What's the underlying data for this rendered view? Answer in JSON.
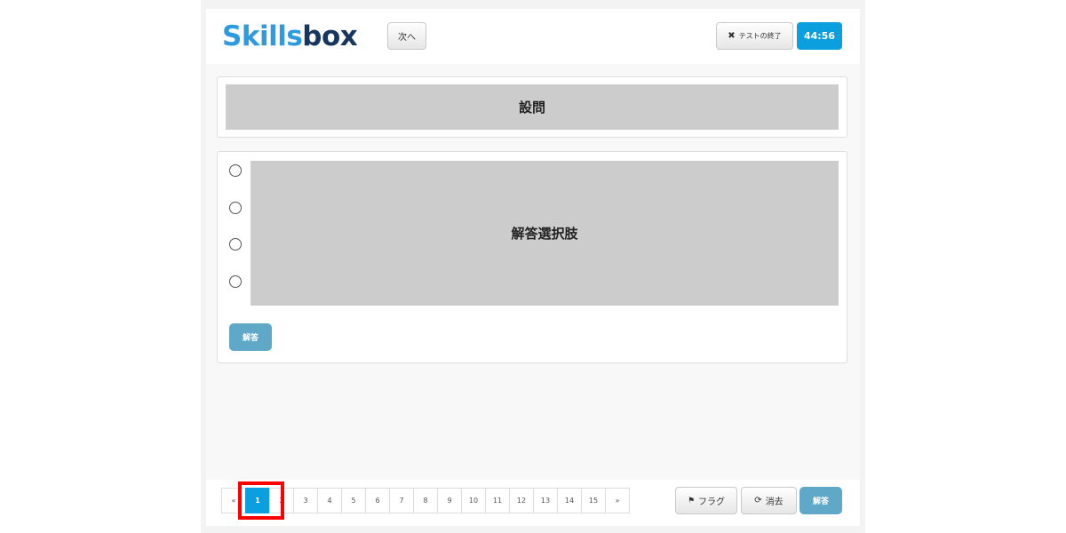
{
  "header": {
    "logo_part1": "Skills",
    "logo_part2": "box",
    "next_label": "次へ",
    "end_icon": "✖",
    "end_label": "テストの終了",
    "timer": "44:56"
  },
  "question": {
    "placeholder": "設問"
  },
  "answers": {
    "placeholder": "解答選択肢",
    "option_count": 4,
    "submit_label": "解答"
  },
  "pagination": {
    "prev": "«",
    "pages": [
      "1",
      "2",
      "3",
      "4",
      "5",
      "6",
      "7",
      "8",
      "9",
      "10",
      "11",
      "12",
      "13",
      "14",
      "15"
    ],
    "next": "»",
    "current": "1"
  },
  "footer": {
    "flag_icon": "⚑",
    "flag_label": "フラグ",
    "clear_icon": "⟳",
    "clear_label": "消去",
    "answer_label": "解答"
  },
  "colors": {
    "accent": "#0c9fe0",
    "answer_button": "#5fa8c8",
    "placeholder_bg": "#cccccc",
    "highlight": "#ff0000",
    "logo_light": "#2d9be0",
    "logo_dark": "#17365f"
  }
}
